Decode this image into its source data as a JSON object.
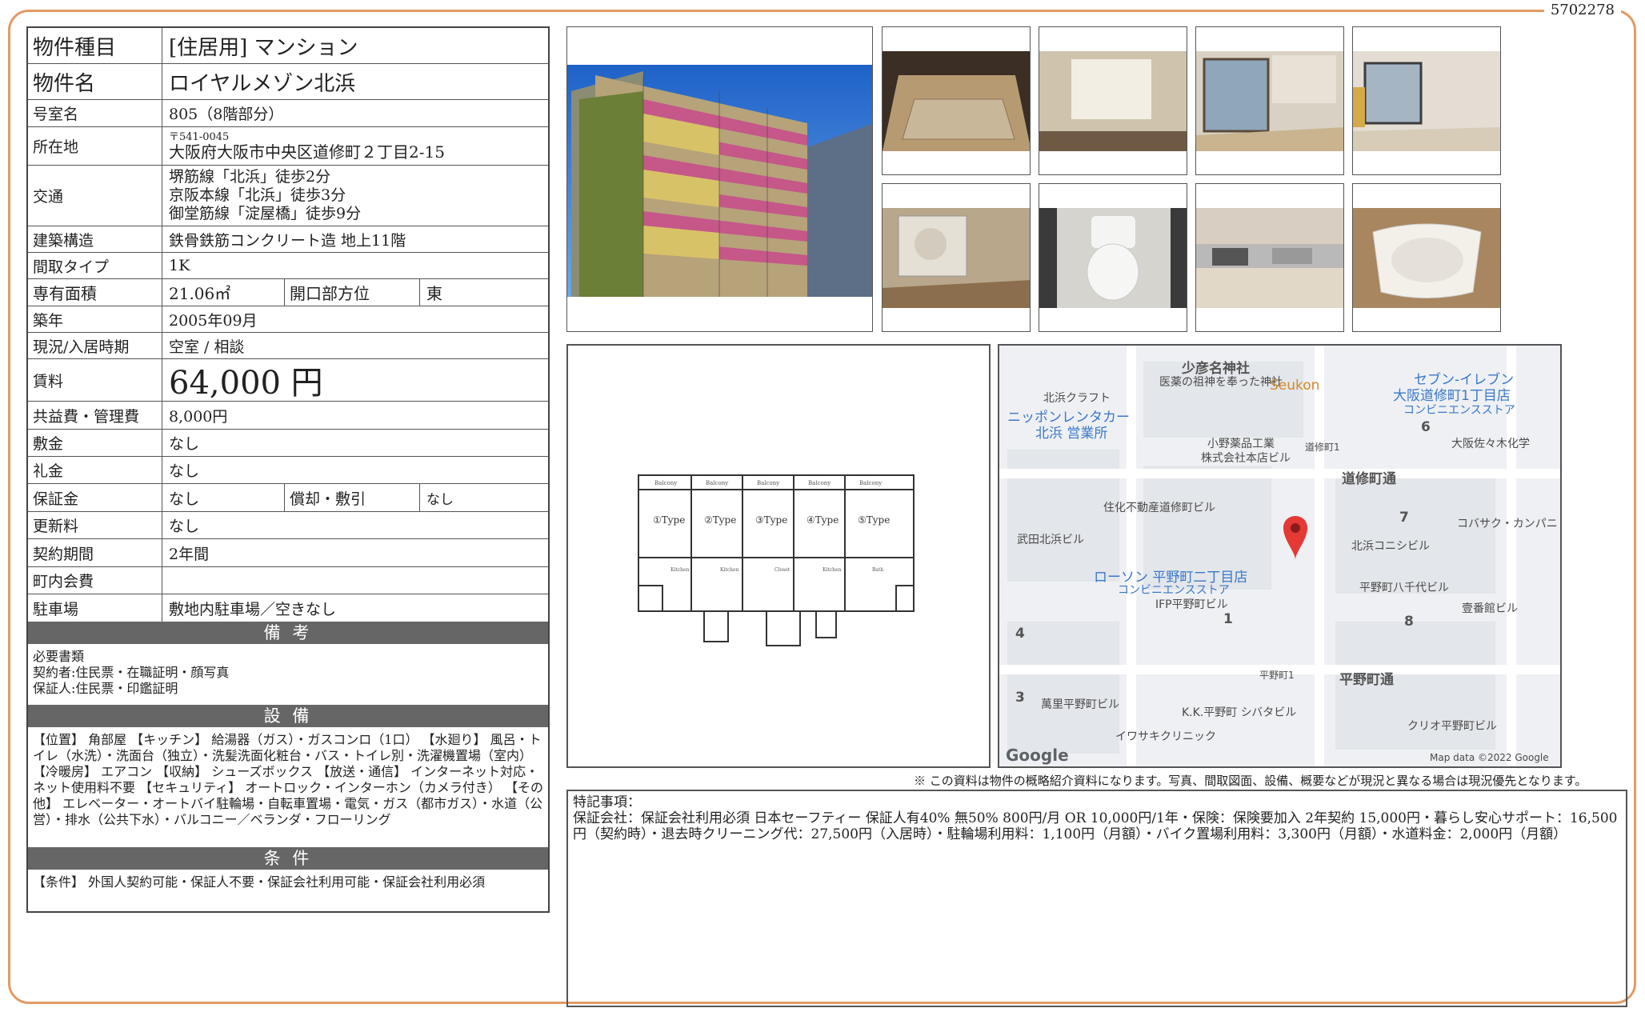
{
  "doc_id": "5702278",
  "property": {
    "rows": [
      {
        "label": "物件種目",
        "value": "[住居用]  マンション"
      },
      {
        "label": "物件名",
        "value": "ロイヤルメゾン北浜"
      },
      {
        "label": "号室名",
        "value": "805（8階部分）"
      },
      {
        "label": "所在地",
        "postal": "〒541-0045",
        "value": "大阪府大阪市中央区道修町２丁目2-15"
      },
      {
        "label": "交通",
        "lines": [
          "堺筋線「北浜」徒歩2分",
          "京阪本線「北浜」徒歩3分",
          "御堂筋線「淀屋橋」徒歩9分"
        ]
      },
      {
        "label": "建築構造",
        "value": "鉄骨鉄筋コンクリート造 地上11階"
      },
      {
        "label": "間取タイプ",
        "value": "1K"
      },
      {
        "label": "専有面積",
        "value": "21.06㎡",
        "label2": "開口部方位",
        "value2": "東"
      },
      {
        "label": "築年",
        "value": "2005年09月"
      },
      {
        "label": "現況/入居時期",
        "value": "空室 /  相談"
      },
      {
        "label": "賃料",
        "value": "64,000 円"
      },
      {
        "label": "共益費・管理費",
        "value": "8,000円"
      },
      {
        "label": "敷金",
        "value": "なし"
      },
      {
        "label": "礼金",
        "value": "なし"
      },
      {
        "label": "保証金",
        "value": "なし",
        "label2": "償却・敷引",
        "value2": "なし"
      },
      {
        "label": "更新料",
        "value": "なし"
      },
      {
        "label": "契約期間",
        "value": "2年間"
      },
      {
        "label": "町内会費",
        "value": ""
      },
      {
        "label": "駐車場",
        "value": "敷地内駐車場／空きなし"
      }
    ],
    "bikou_title": "備 考",
    "bikou_lines": [
      "必要書類",
      "契約者:住民票・在職証明・顔写真",
      "保証人:住民票・印鑑証明"
    ],
    "setsubi_title": "設 備",
    "setsubi_text": "【位置】 角部屋 【キッチン】 給湯器（ガス）・ガスコンロ（1口） 【水廻り】 風呂・トイレ（水洗）・洗面台（独立）・洗髪洗面化粧台・バス・トイレ別・洗濯機置場（室内） 【冷暖房】 エアコン 【収納】 シューズボックス 【放送・通信】 インターネット対応・ネット使用料不要 【セキュリティ】 オートロック・インターホン（カメラ付き） 【その他】 エレベーター・オートバイ駐輪場・自転車置場・電気・ガス（都市ガス）・水道（公営）・排水（公共下水）・バルコニー／ベランダ・フローリング",
    "jouken_title": "条 件",
    "jouken_text": "【条件】 外国人契約可能・保証人不要・保証会社利用可能・保証会社利用必須"
  },
  "floorplan": {
    "types": [
      "①Type",
      "②Type",
      "③Type",
      "④Type",
      "⑤Type"
    ],
    "balcony": "Balcony",
    "closet": "Closet",
    "kitchen": "Kitchen",
    "bath": "Bath"
  },
  "map": {
    "labels": {
      "shrine": "少彦名神社",
      "shrine_sub": "医薬の祖神を奉った神社",
      "seukon": "Seukon",
      "seven": "セブン-イレブン",
      "seven2": "大阪道修町1丁目店",
      "conv": "コンビニエンスストア",
      "kitahama_craft": "北浜クラフト",
      "nippon_rent": "ニッポンレンタカー",
      "nippon_rent2": "北浜 営業所",
      "ono": "小野薬品工業",
      "ono2": "株式会社本店ビル",
      "doshomachi1": "道修町1",
      "n6": "6",
      "osaka_sasaki": "大阪佐々木化学",
      "doshomachi_dori": "道修町通",
      "sumika": "住化不動産道修町ビル",
      "takeda": "武田北浜ビル",
      "n7": "7",
      "kobasaku": "コバサク・カンパニ",
      "kitahama_koni": "北浜コニシビル",
      "lawson": "ローソン 平野町二丁目店",
      "lawson2": "コンビニエンスストア",
      "ifp": "IFP平野町ビル",
      "n1": "1",
      "hirano8": "平野町八千代ビル",
      "n8": "8",
      "ichiban": "壹番館ビル",
      "n4": "4",
      "hirano1": "平野町1",
      "hirano_dori": "平野町通",
      "n3": "3",
      "mansato": "萬里平野町ビル",
      "kk": "K.K.平野町 シバタビル",
      "iwasaki": "イワサキクリニック",
      "clio": "クリオ平野町ビル",
      "google": "Google",
      "mapdata": "Map data ©2022 Google"
    }
  },
  "note": "※ この資料は物件の概略紹介資料になります。写真、間取図面、設備、概要などが現況と異なる場合は現況優先となります。",
  "remarks": {
    "title": "特記事項：",
    "text": "保証会社：保証会社利用必須 日本セーフティー 保証人有40% 無50% 800円/月 OR 10,000円/1年・保険：保険要加入 2年契約 15,000円・暮らし安心サポート：16,500円（契約時）・退去時クリーニング代：27,500円（入居時）・駐輪場利用料：1,100円（月額）・バイク置場利用料：3,300円（月額）・水道料金：2,000円（月額）"
  },
  "colors": {
    "frame": "#e39a63",
    "header_bar": "#666666"
  }
}
